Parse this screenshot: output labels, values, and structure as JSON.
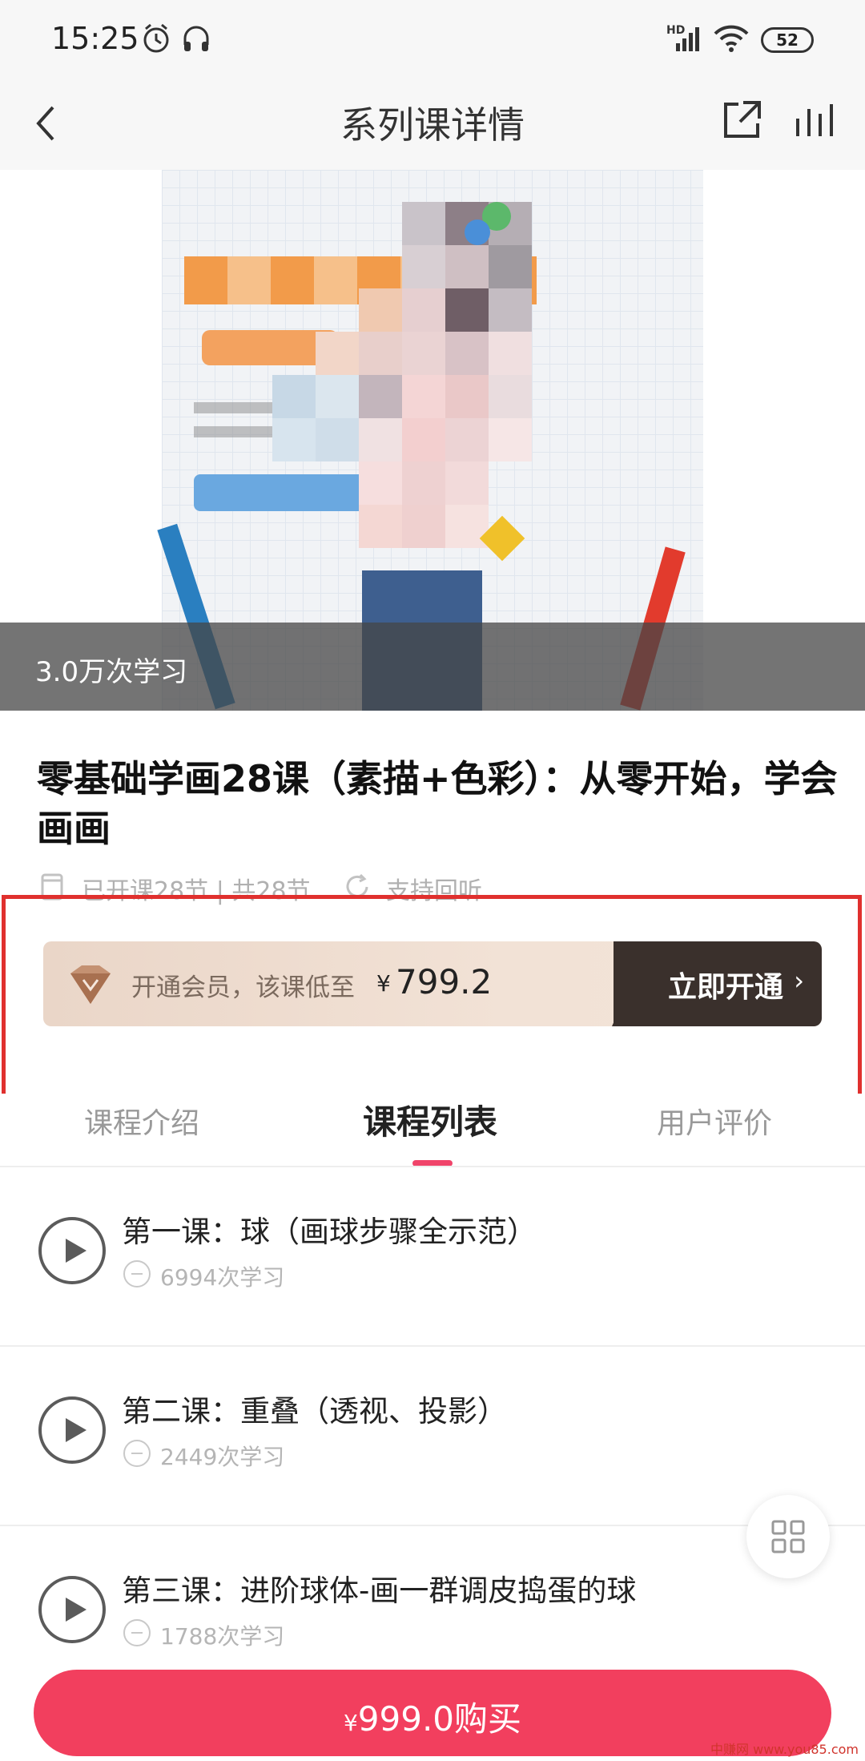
{
  "status_bar": {
    "time": "15:25",
    "battery": "52",
    "network": "HD"
  },
  "nav": {
    "title": "系列课详情"
  },
  "hero": {
    "study_count": "3.0万次学习"
  },
  "course": {
    "title": "零基础学画28课（素描+色彩）：从零开始，学会画画",
    "sessions": "已开课28节 | 共28节",
    "replay": "支持回听"
  },
  "promo": {
    "text": "开通会员，该课低至",
    "currency": "¥",
    "price": "799.2",
    "action": "立即开通"
  },
  "tabs": [
    {
      "label": "课程介绍"
    },
    {
      "label": "课程列表"
    },
    {
      "label": "用户评价"
    }
  ],
  "lessons": [
    {
      "title": "第一课：球（画球步骤全示范）",
      "count": "6994次学习"
    },
    {
      "title": "第二课：重叠（透视、投影）",
      "count": "2449次学习"
    },
    {
      "title": "第三课：进阶球体-画一群调皮捣蛋的球",
      "count": "1788次学习"
    }
  ],
  "buy": {
    "currency": "¥",
    "label": "999.0购买"
  },
  "watermark": "中赚网 www.you85.com",
  "colors": {
    "accent": "#f23f5e",
    "promo_dark": "#3a302c",
    "highlight": "#e0302e"
  }
}
